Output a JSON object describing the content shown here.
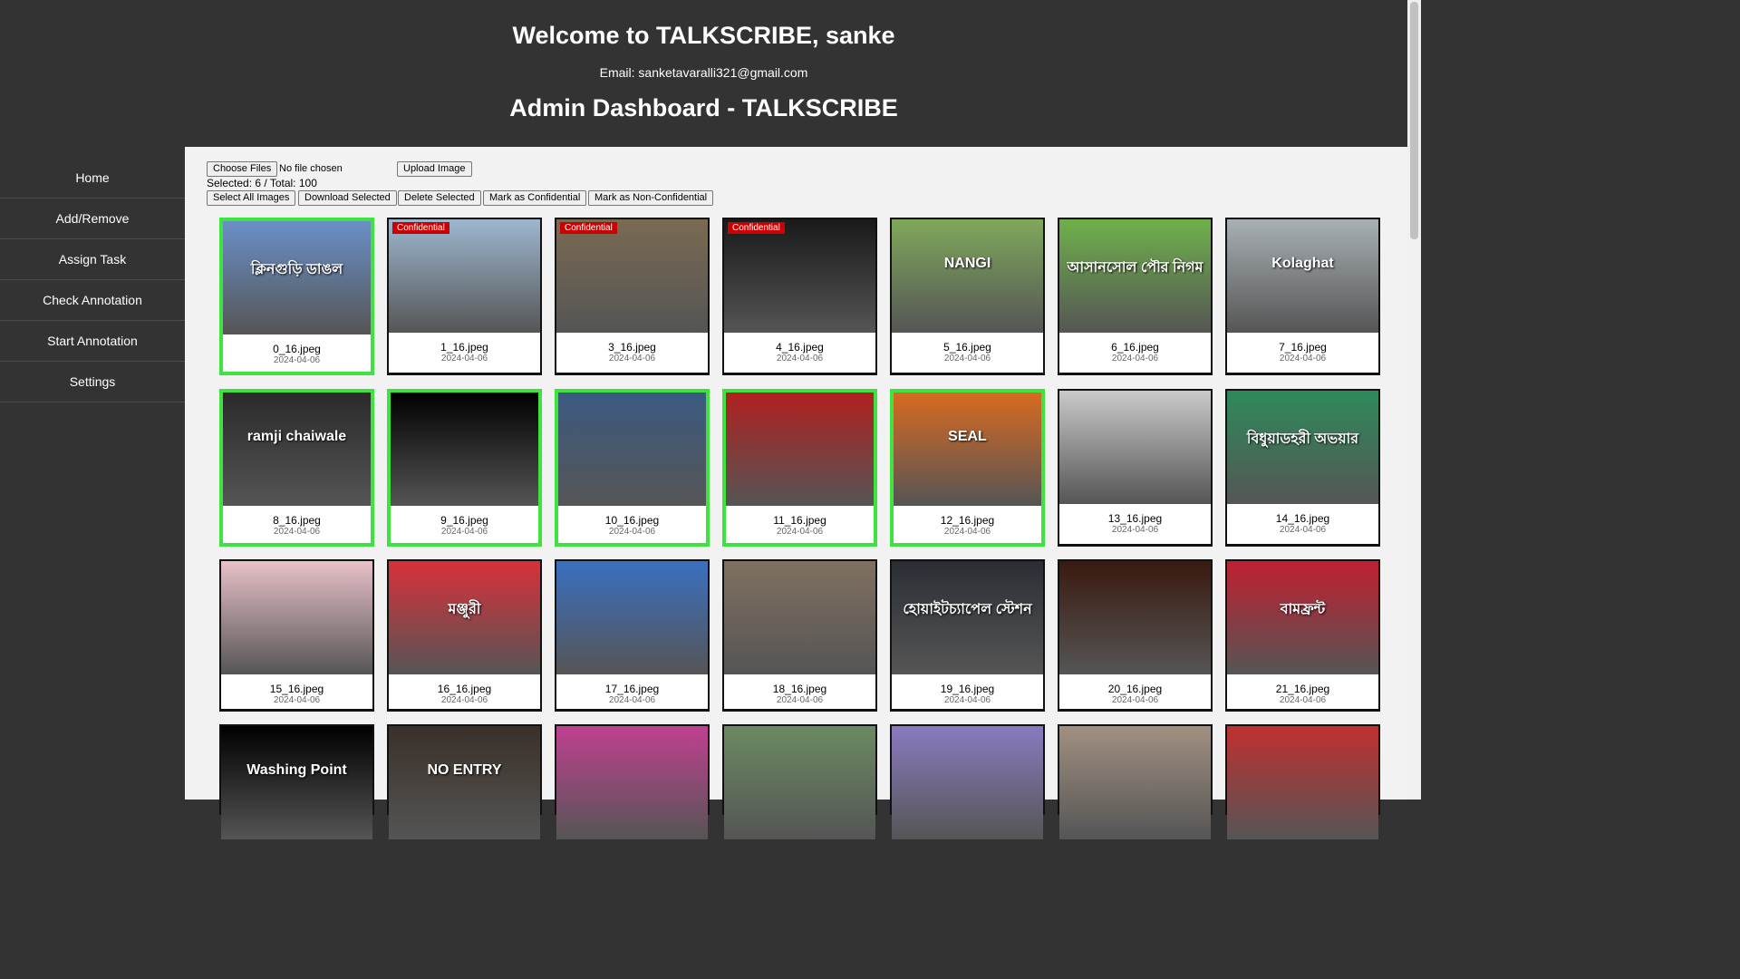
{
  "header": {
    "welcome": "Welcome to TALKSCRIBE, sanke",
    "email": "Email: sanketavaralli321@gmail.com",
    "admin_title": "Admin Dashboard - TALKSCRIBE"
  },
  "sidebar": {
    "items": [
      {
        "label": "Home"
      },
      {
        "label": "Add/Remove"
      },
      {
        "label": "Assign Task"
      },
      {
        "label": "Check Annotation"
      },
      {
        "label": "Start Annotation"
      },
      {
        "label": "Settings"
      }
    ]
  },
  "toolbar": {
    "choose_files": "Choose Files",
    "no_file": "No file chosen",
    "upload": "Upload Image",
    "selected_text": "Selected: 6 / Total: 100",
    "select_all": "Select All Images",
    "download_selected": "Download Selected",
    "delete_selected": "Delete Selected",
    "mark_confidential": "Mark as Confidential",
    "mark_non_confidential": "Mark as Non-Confidential"
  },
  "confidential_label": "Confidential",
  "images": [
    {
      "name": "0_16.jpeg",
      "date": "2024-04-06",
      "selected": true,
      "confidential": false,
      "text": "ক্লিনগুড়ি ডাঙল"
    },
    {
      "name": "1_16.jpeg",
      "date": "2024-04-06",
      "selected": false,
      "confidential": true,
      "text": ""
    },
    {
      "name": "3_16.jpeg",
      "date": "2024-04-06",
      "selected": false,
      "confidential": true,
      "text": ""
    },
    {
      "name": "4_16.jpeg",
      "date": "2024-04-06",
      "selected": false,
      "confidential": true,
      "text": ""
    },
    {
      "name": "5_16.jpeg",
      "date": "2024-04-06",
      "selected": false,
      "confidential": false,
      "text": "NANGI"
    },
    {
      "name": "6_16.jpeg",
      "date": "2024-04-06",
      "selected": false,
      "confidential": false,
      "text": "আসানসোল পৌর নিগম"
    },
    {
      "name": "7_16.jpeg",
      "date": "2024-04-06",
      "selected": false,
      "confidential": false,
      "text": "Kolaghat"
    },
    {
      "name": "8_16.jpeg",
      "date": "2024-04-06",
      "selected": true,
      "confidential": false,
      "text": "ramji chaiwale"
    },
    {
      "name": "9_16.jpeg",
      "date": "2024-04-06",
      "selected": true,
      "confidential": false,
      "text": ""
    },
    {
      "name": "10_16.jpeg",
      "date": "2024-04-06",
      "selected": true,
      "confidential": false,
      "text": ""
    },
    {
      "name": "11_16.jpeg",
      "date": "2024-04-06",
      "selected": true,
      "confidential": false,
      "text": ""
    },
    {
      "name": "12_16.jpeg",
      "date": "2024-04-06",
      "selected": true,
      "confidential": false,
      "text": "SEAL"
    },
    {
      "name": "13_16.jpeg",
      "date": "2024-04-06",
      "selected": false,
      "confidential": false,
      "text": ""
    },
    {
      "name": "14_16.jpeg",
      "date": "2024-04-06",
      "selected": false,
      "confidential": false,
      "text": "বিধুয়াডহরী অভয়ার"
    },
    {
      "name": "15_16.jpeg",
      "date": "2024-04-06",
      "selected": false,
      "confidential": false,
      "text": ""
    },
    {
      "name": "16_16.jpeg",
      "date": "2024-04-06",
      "selected": false,
      "confidential": false,
      "text": "মঞ্জুরী"
    },
    {
      "name": "17_16.jpeg",
      "date": "2024-04-06",
      "selected": false,
      "confidential": false,
      "text": ""
    },
    {
      "name": "18_16.jpeg",
      "date": "2024-04-06",
      "selected": false,
      "confidential": false,
      "text": ""
    },
    {
      "name": "19_16.jpeg",
      "date": "2024-04-06",
      "selected": false,
      "confidential": false,
      "text": "হোয়াইটচ্যাপেল স্টেশন"
    },
    {
      "name": "20_16.jpeg",
      "date": "2024-04-06",
      "selected": false,
      "confidential": false,
      "text": ""
    },
    {
      "name": "21_16.jpeg",
      "date": "2024-04-06",
      "selected": false,
      "confidential": false,
      "text": "বামফ্রন্ট"
    },
    {
      "name": "",
      "date": "",
      "selected": false,
      "confidential": false,
      "text": "Washing Point"
    },
    {
      "name": "",
      "date": "",
      "selected": false,
      "confidential": false,
      "text": "NO ENTRY"
    },
    {
      "name": "",
      "date": "",
      "selected": false,
      "confidential": false,
      "text": ""
    },
    {
      "name": "",
      "date": "",
      "selected": false,
      "confidential": false,
      "text": ""
    },
    {
      "name": "",
      "date": "",
      "selected": false,
      "confidential": false,
      "text": ""
    },
    {
      "name": "",
      "date": "",
      "selected": false,
      "confidential": false,
      "text": ""
    },
    {
      "name": "",
      "date": "",
      "selected": false,
      "confidential": false,
      "text": ""
    }
  ],
  "thumb_colors": [
    "#6a8fc7",
    "#9db7d0",
    "#7a6a52",
    "#1a1a1a",
    "#7fa85a",
    "#6fb04a",
    "#a8b0b4",
    "#2a2a2a",
    "#000000",
    "#3a5a80",
    "#b02020",
    "#d86a20",
    "#c9c9c9",
    "#2e8a5a",
    "#e8c0c8",
    "#d8303a",
    "#3a6fc0",
    "#807060",
    "#2a2e34",
    "#3a1a10",
    "#c02030",
    "#000000",
    "#3a3028",
    "#c04090",
    "#6a8a60",
    "#8a7ac0",
    "#a09080",
    "#c03030"
  ]
}
